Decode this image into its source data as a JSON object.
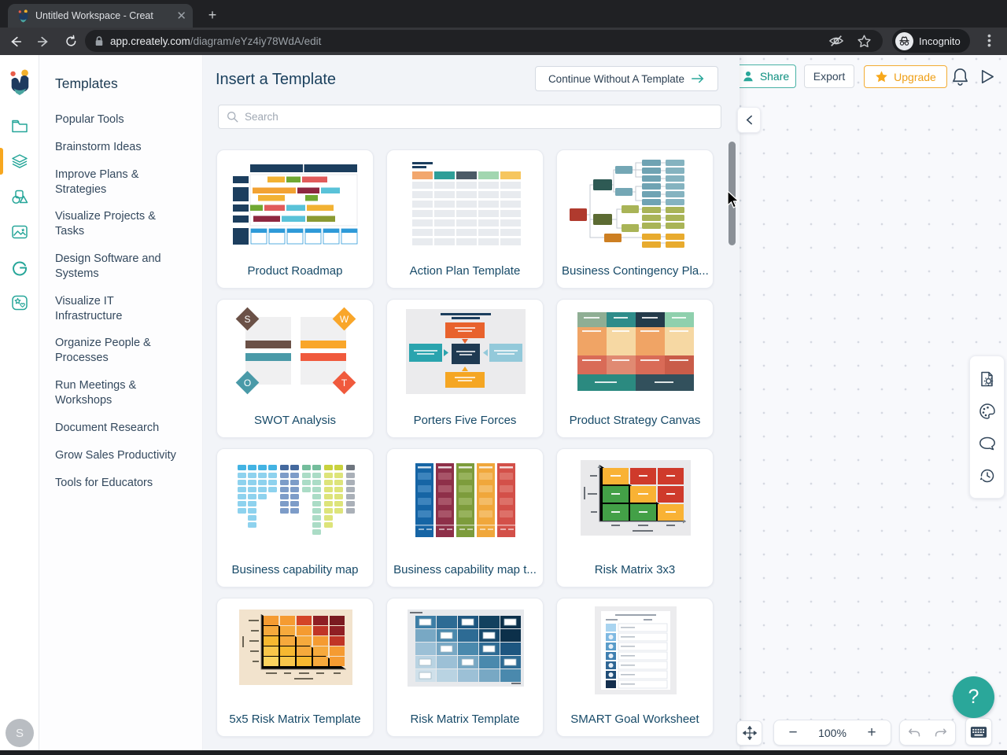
{
  "browser": {
    "tab_title": "Untitled Workspace - Creat",
    "url_domain": "app.creately.com",
    "url_path": "/diagram/eYz4iy78WdA/edit",
    "incognito_label": "Incognito"
  },
  "templates_panel": {
    "title": "Templates",
    "items": [
      "Popular Tools",
      "Brainstorm Ideas",
      "Improve Plans & Strategies",
      "Visualize Projects & Tasks",
      "Design Software and Systems",
      "Visualize IT Infrastructure",
      "Organize People & Processes",
      "Run Meetings & Workshops",
      "Document Research",
      "Grow Sales Productivity",
      "Tools for Educators"
    ]
  },
  "browser_panel": {
    "title": "Insert a Template",
    "continue_button": "Continue Without A Template",
    "search_placeholder": "Search",
    "cards": [
      {
        "title": "Product Roadmap"
      },
      {
        "title": "Action Plan Template"
      },
      {
        "title": "Business Contingency Pla..."
      },
      {
        "title": "SWOT Analysis"
      },
      {
        "title": "Porters Five Forces"
      },
      {
        "title": "Product Strategy Canvas"
      },
      {
        "title": "Business capability map"
      },
      {
        "title": "Business capability map t..."
      },
      {
        "title": "Risk Matrix 3x3"
      },
      {
        "title": "5x5 Risk Matrix Template"
      },
      {
        "title": "Risk Matrix Template"
      },
      {
        "title": "SMART Goal Worksheet"
      }
    ]
  },
  "thumb_text": {
    "swot": [
      "S",
      "W",
      "O",
      "T"
    ]
  },
  "topbar": {
    "share": "Share",
    "export": "Export",
    "upgrade": "Upgrade"
  },
  "controls": {
    "zoom_level": "100%",
    "help": "?",
    "avatar_initial": "S"
  },
  "colors": {
    "accent_teal": "#26a699",
    "upgrade_orange": "#f2a33c",
    "navy_text": "#1c415e",
    "active_indicator": "#f7a71f"
  }
}
